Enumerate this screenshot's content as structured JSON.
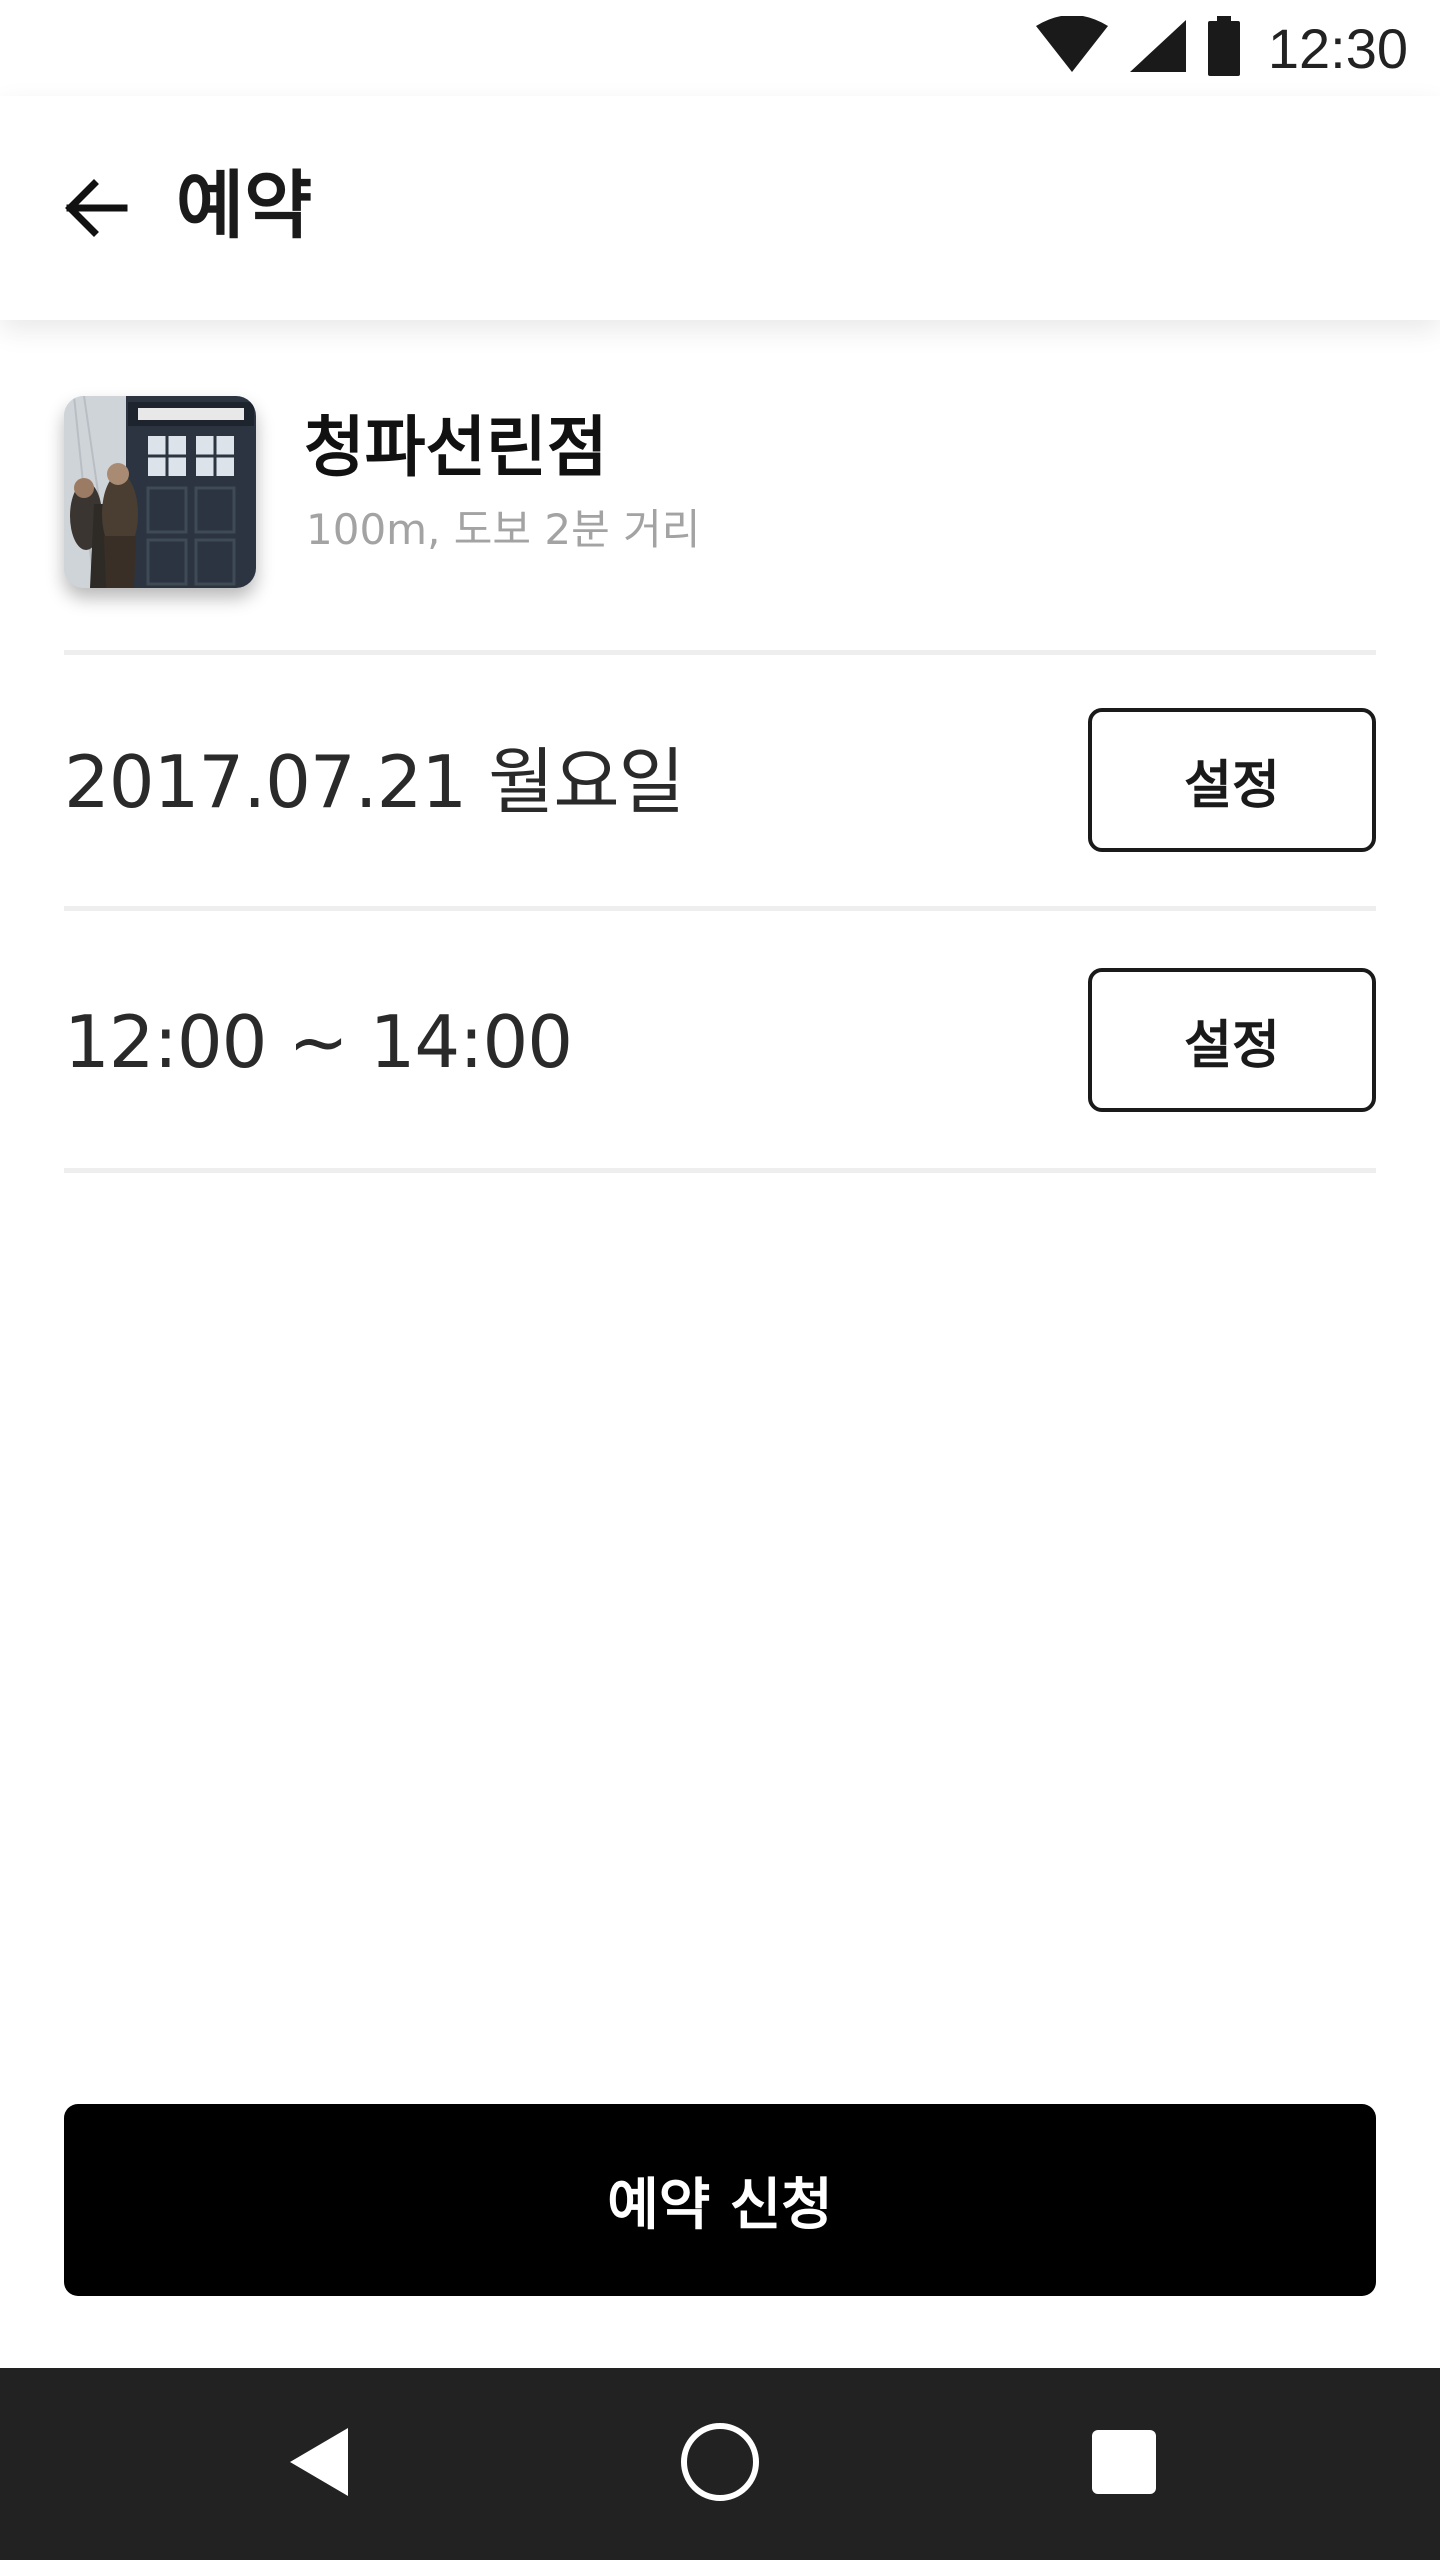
{
  "status_bar": {
    "time": "12:30",
    "icons": [
      "wifi-icon",
      "cellular-signal-icon",
      "battery-icon"
    ]
  },
  "app_bar": {
    "back_icon": "arrow-left-icon",
    "title": "예약"
  },
  "store": {
    "name": "청파선린점",
    "distance": "100m, 도보 2분 거리",
    "thumbnail": "police-box-photo"
  },
  "reservation": {
    "date": "2017.07.21 월요일",
    "date_button": "설정",
    "time": "12:00 ~ 14:00",
    "time_button": "설정"
  },
  "submit": {
    "label": "예약 신청"
  },
  "nav_bar": {
    "icons": [
      "back-triangle-icon",
      "home-circle-icon",
      "recents-square-icon"
    ]
  },
  "colors": {
    "primary": "#000000",
    "text": "#222222",
    "subtext": "#a3a3a3",
    "divider": "#eeeeee",
    "nav_bar": "#222222"
  }
}
